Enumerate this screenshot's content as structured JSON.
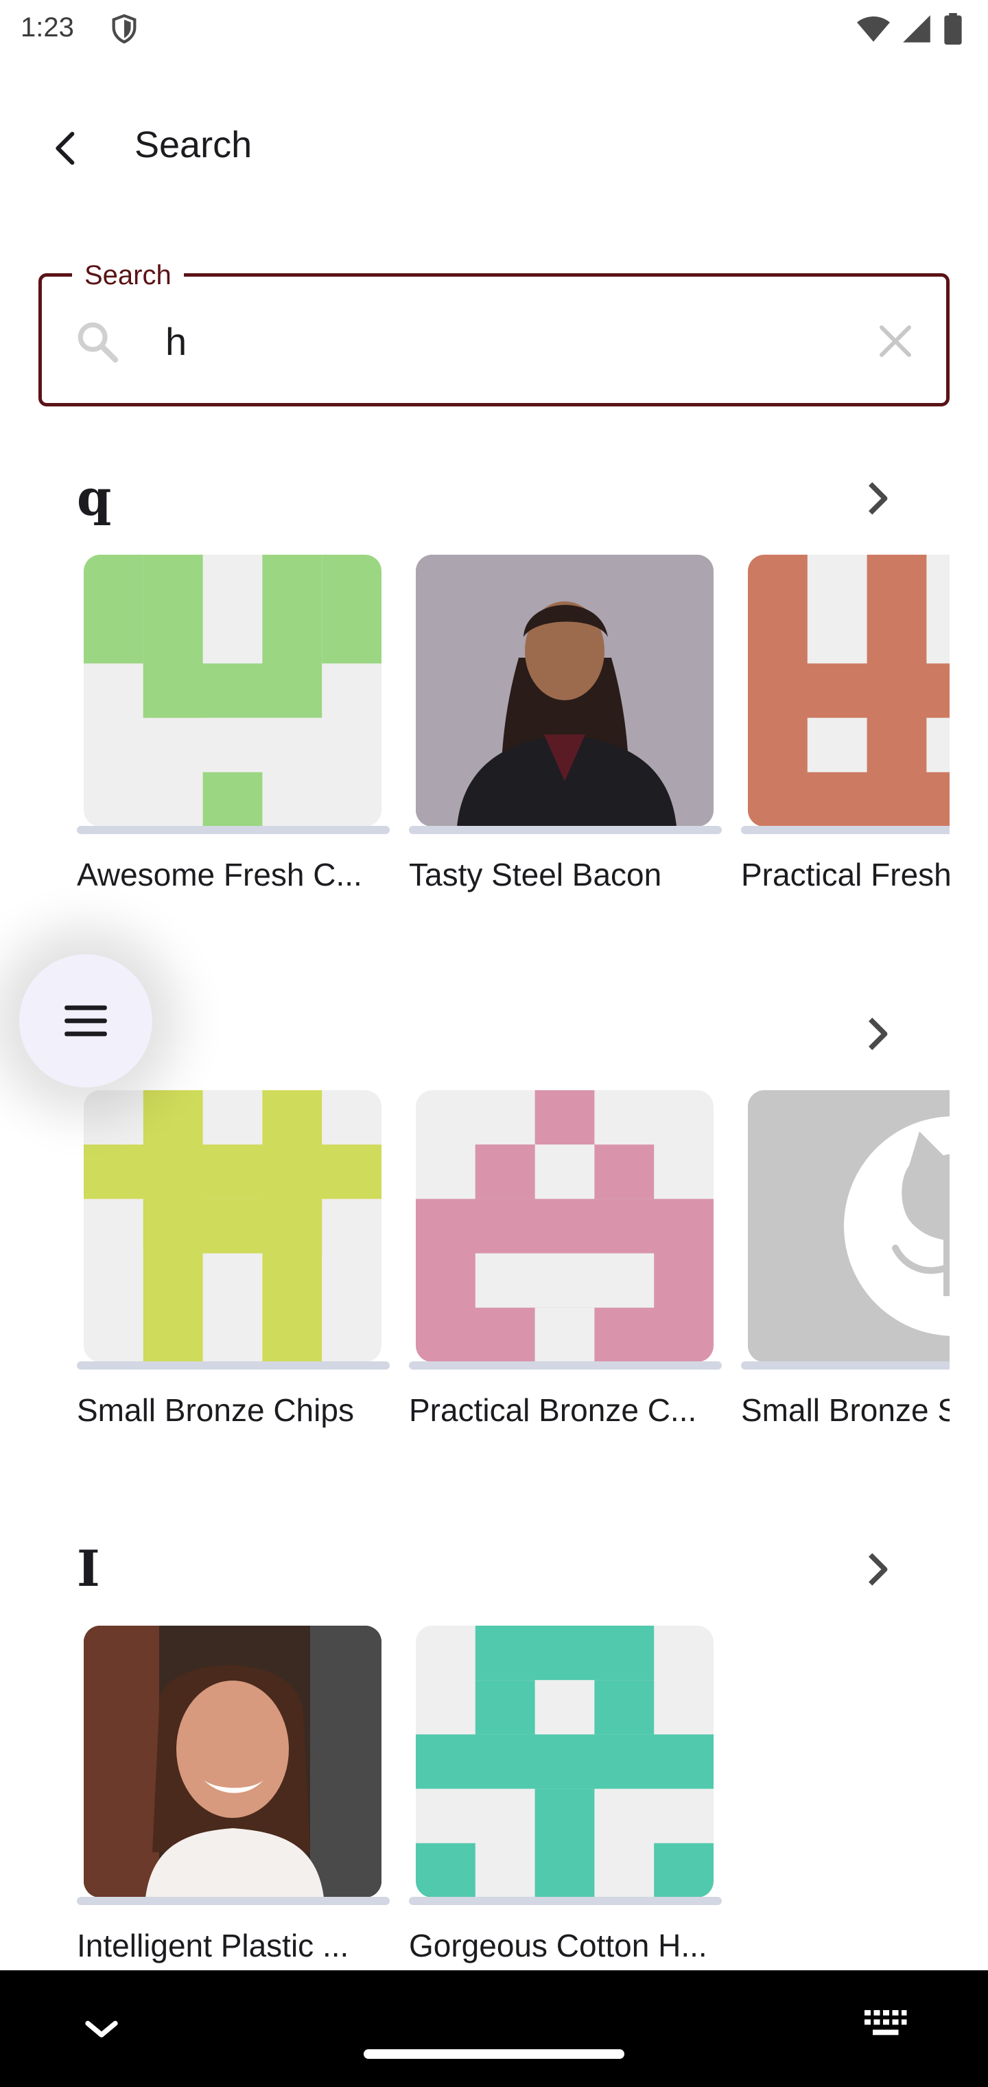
{
  "status_bar": {
    "time": "1:23"
  },
  "app_bar": {
    "title": "Search"
  },
  "search": {
    "label": "Search",
    "value": "h"
  },
  "sections": [
    {
      "title": "q",
      "items": [
        {
          "label": "Awesome Fresh C...",
          "image": "identicon"
        },
        {
          "label": "Tasty Steel Bacon",
          "image": "photo-woman-business-suit"
        },
        {
          "label": "Practical Fresh",
          "image": "identicon"
        }
      ]
    },
    {
      "title": "",
      "items": [
        {
          "label": "Small Bronze Chips",
          "image": "identicon"
        },
        {
          "label": "Practical Bronze C...",
          "image": "identicon"
        },
        {
          "label": "Small Bronze S",
          "image": "github-octocat-logo"
        }
      ]
    },
    {
      "title": "I",
      "items": [
        {
          "label": "Intelligent Plastic ...",
          "image": "photo-smiling-woman"
        },
        {
          "label": "Gorgeous Cotton H...",
          "image": "identicon"
        }
      ]
    }
  ],
  "colors": {
    "accent": "#5a1316",
    "identicon_green": "#9bd682",
    "identicon_orange": "#cd7a62",
    "identicon_lime": "#cfdb5a",
    "identicon_pink": "#d994ac",
    "identicon_teal": "#51c9ac",
    "card_background": "#efefef",
    "underline": "#d3d7e3"
  },
  "icons": [
    "shield-icon",
    "wifi-icon",
    "signal-icon",
    "battery-icon",
    "back-arrow-icon",
    "search-icon",
    "clear-icon",
    "chevron-right-icon",
    "menu-icon",
    "chevron-down-icon",
    "keyboard-icon"
  ]
}
